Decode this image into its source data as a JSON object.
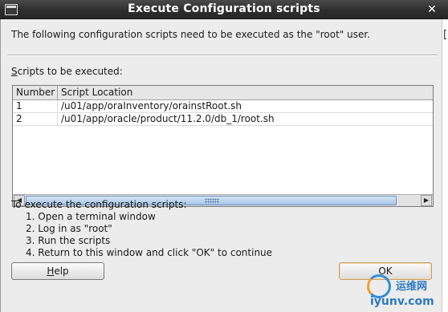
{
  "window": {
    "title": "Execute Configuration scripts",
    "close_glyph": "✕",
    "right_bracket": "["
  },
  "dialog": {
    "message": "The following configuration scripts need to be executed as the \"root\" user.",
    "scripts_label_mnemonic": "S",
    "scripts_label_rest": "cripts to be executed:",
    "table": {
      "headers": [
        "Number",
        "Script Location"
      ],
      "rows": [
        {
          "number": "1",
          "location": "/u01/app/oraInventory/orainstRoot.sh"
        },
        {
          "number": "2",
          "location": "/u01/app/oracle/product/11.2.0/db_1/root.sh"
        }
      ]
    },
    "instructions_title": "To execute the configuration scripts:",
    "instructions": [
      "1. Open a terminal window",
      "2. Log in as \"root\"",
      "3. Run the scripts",
      "4. Return to this window and click \"OK\" to continue"
    ],
    "help_mnemonic": "H",
    "help_rest": "elp",
    "ok_label": "OK"
  },
  "watermark": {
    "cn": "运维网",
    "url": "iyunv.com"
  },
  "colors": {
    "titlebar": "#2e2e2e",
    "dialog_bg": "#ececec",
    "scroll_thumb": "#a9c6e6",
    "watermark": "#2c79c4"
  },
  "icons": {
    "window_menu": "window-menu-icon",
    "close": "close-icon",
    "scroll_left": "arrow-left-icon",
    "scroll_right": "arrow-right-icon"
  }
}
